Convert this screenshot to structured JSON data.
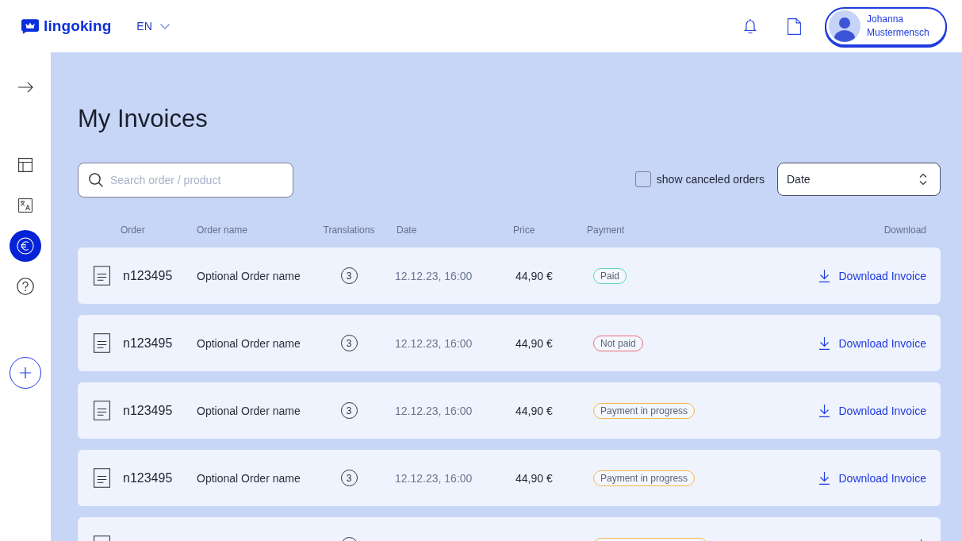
{
  "header": {
    "logo": "lingoking",
    "language": "EN",
    "user": {
      "name": "Johanna Mustermensch"
    }
  },
  "sidebar": {
    "items": [
      {
        "kind": "layout",
        "selected": false
      },
      {
        "kind": "translate",
        "selected": false
      },
      {
        "kind": "invoices",
        "selected": true
      },
      {
        "kind": "help",
        "selected": false
      }
    ]
  },
  "page": {
    "title": "My Invoices"
  },
  "filters": {
    "search": {
      "placeholder": "Search order / product"
    },
    "show_canceled": {
      "label": "show canceled orders",
      "checked": false
    },
    "sort": {
      "value": "Date"
    }
  },
  "table": {
    "columns": [
      "Order",
      "Order name",
      "Translations",
      "Date",
      "Price",
      "Payment",
      "Download"
    ],
    "rows": [
      {
        "order": "n123495",
        "name": "Optional Order name",
        "translations": "3",
        "date": "12.12.23, 16:00",
        "price": "44,90 €",
        "payment": {
          "label": "Paid",
          "color": "#62d6b4"
        },
        "download": "Download Invoice"
      },
      {
        "order": "n123495",
        "name": "Optional Order name",
        "translations": "3",
        "date": "12.12.23, 16:00",
        "price": "44,90 €",
        "payment": {
          "label": "Not paid",
          "color": "#ec6a78"
        },
        "download": "Download Invoice"
      },
      {
        "order": "n123495",
        "name": "Optional Order name",
        "translations": "3",
        "date": "12.12.23, 16:00",
        "price": "44,90 €",
        "payment": {
          "label": "Payment in progress",
          "color": "#f2b54a"
        },
        "download": "Download Invoice"
      },
      {
        "order": "n123495",
        "name": "Optional Order name",
        "translations": "3",
        "date": "12.12.23, 16:00",
        "price": "44,90 €",
        "payment": {
          "label": "Payment in progress",
          "color": "#f2b54a"
        },
        "download": "Download Invoice"
      },
      {
        "payment": {
          "color": "#f2b54a"
        }
      }
    ]
  }
}
